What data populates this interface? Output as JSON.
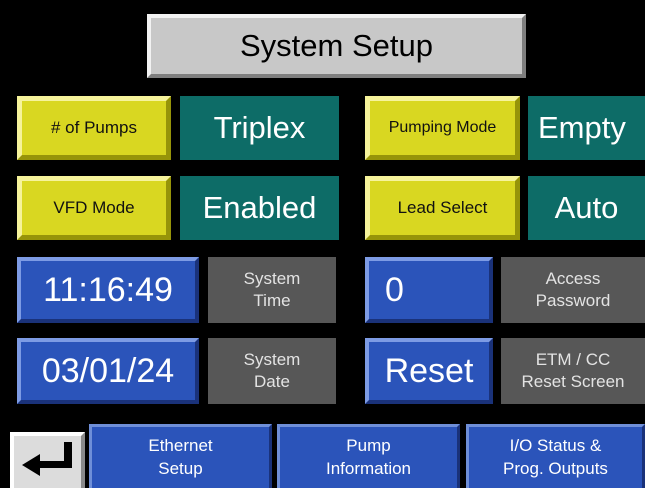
{
  "header": {
    "title": "System Setup"
  },
  "settings": {
    "pumps_label": "# of Pumps",
    "pumps_value": "Triplex",
    "pumping_mode_label": "Pumping Mode",
    "pumping_mode_value": "Empty",
    "vfd_label": "VFD Mode",
    "vfd_value": "Enabled",
    "lead_label": "Lead Select",
    "lead_value": "Auto"
  },
  "time": {
    "value": "11:16:49",
    "label": "System\nTime"
  },
  "date": {
    "value": "03/01/24",
    "label": "System\nDate"
  },
  "password": {
    "value": "0",
    "label": "Access\nPassword"
  },
  "reset": {
    "button": "Reset",
    "label": "ETM / CC\nReset Screen"
  },
  "nav": {
    "back_icon": "return-arrow-icon",
    "ethernet": "Ethernet\nSetup",
    "pump_info": "Pump\nInformation",
    "io_status": "I/O Status &\nProg. Outputs"
  },
  "colors": {
    "background": "#000000",
    "yellow_button": "#d9d721",
    "teal_value": "#0d6c67",
    "blue_button": "#2b54ba",
    "gray_label": "#575757",
    "title_panel": "#c8c8c8"
  }
}
